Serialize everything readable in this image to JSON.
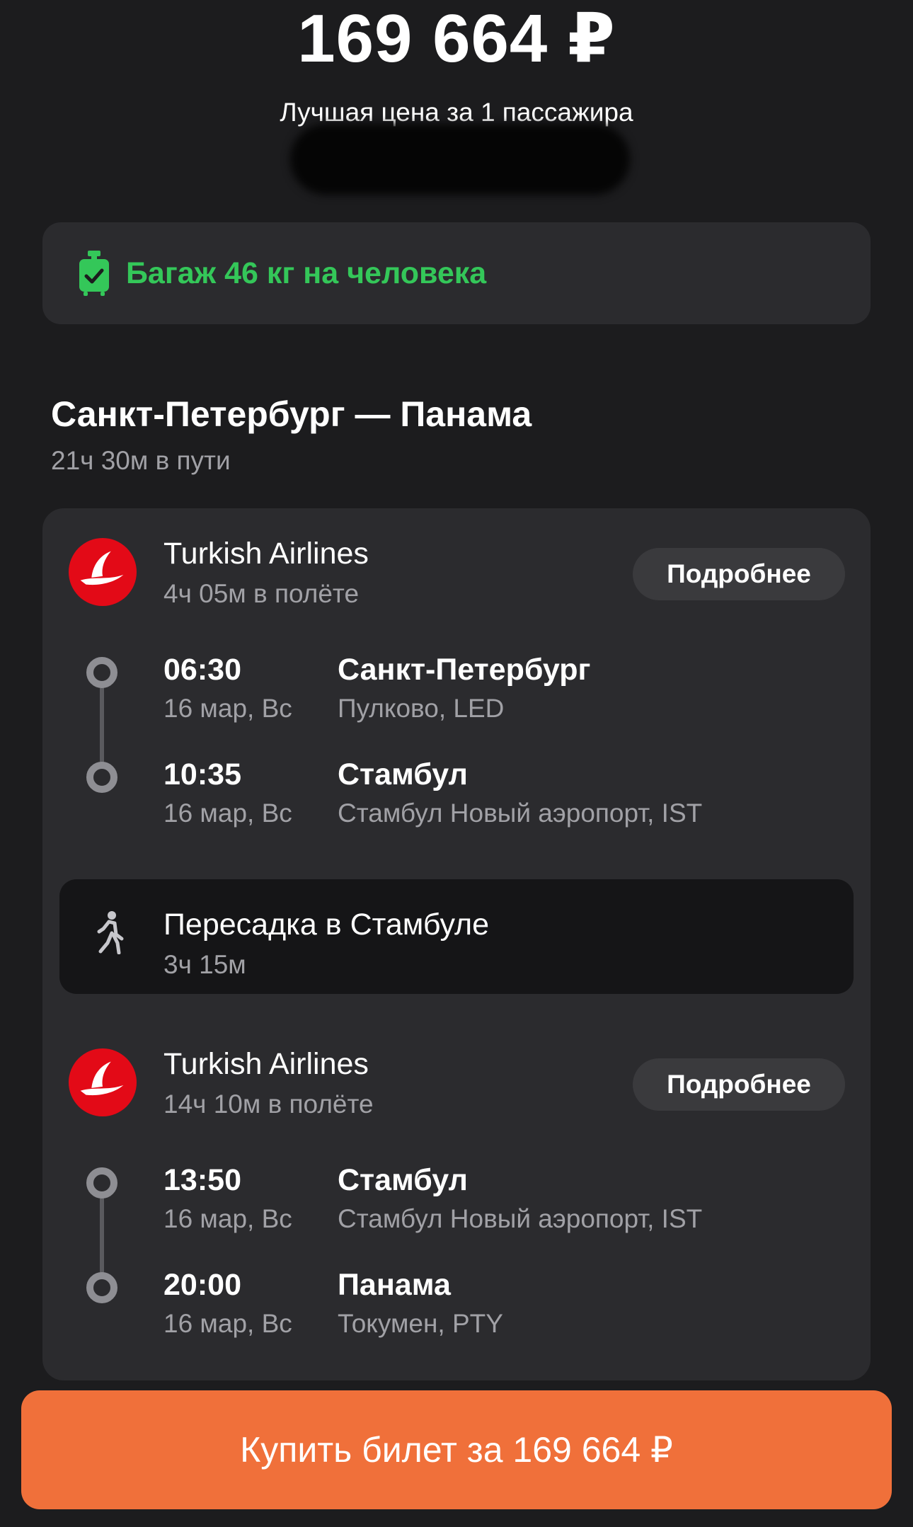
{
  "header": {
    "price": "169 664 ₽",
    "price_caption": "Лучшая цена за 1 пассажира"
  },
  "baggage": {
    "icon": "suitcase-check-icon",
    "text": "Багаж 46 кг на человека",
    "color": "#34c759"
  },
  "route": {
    "title": "Санкт-Петербург — Панама",
    "total_duration": "21ч 30м в пути"
  },
  "segments": [
    {
      "airline": "Turkish Airlines",
      "flight_duration": "4ч 05м в полёте",
      "details_label": "Подробнее",
      "departure": {
        "time": "06:30",
        "date": "16 мар, Вс",
        "city": "Санкт-Петербург",
        "airport": "Пулково, LED"
      },
      "arrival": {
        "time": "10:35",
        "date": "16 мар, Вс",
        "city": "Стамбул",
        "airport": "Стамбул Новый аэропорт, IST"
      }
    },
    {
      "airline": "Turkish Airlines",
      "flight_duration": "14ч 10м в полёте",
      "details_label": "Подробнее",
      "departure": {
        "time": "13:50",
        "date": "16 мар, Вс",
        "city": "Стамбул",
        "airport": "Стамбул Новый аэропорт, IST"
      },
      "arrival": {
        "time": "20:00",
        "date": "16 мар, Вс",
        "city": "Панама",
        "airport": "Токумен, PTY"
      }
    }
  ],
  "transfer": {
    "icon": "walking-person-icon",
    "title": "Пересадка в Стамбуле",
    "duration": "3ч 15м"
  },
  "buy_button": {
    "label": "Купить билет за 169 664 ₽",
    "color": "#f0703a"
  }
}
